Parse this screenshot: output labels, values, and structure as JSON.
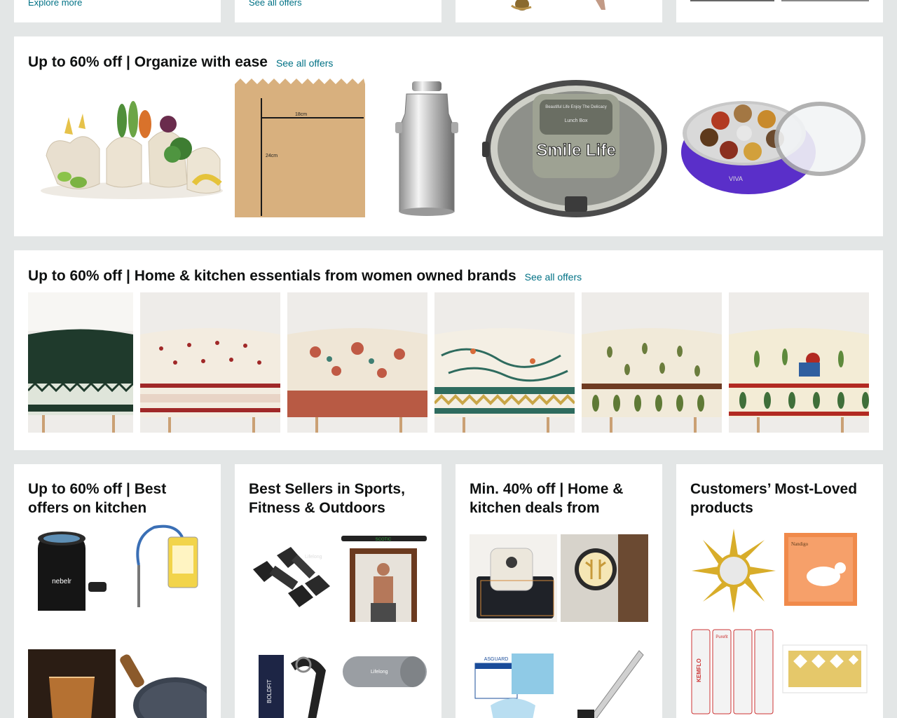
{
  "top_cards": {
    "card1_link": "Explore more",
    "card2_link": "See all offers"
  },
  "organize_row": {
    "title": "Up to 60% off | Organize with ease",
    "link": "See all offers",
    "products": [
      {
        "icon": "vegetable-bags-image"
      },
      {
        "icon": "paper-bag-image",
        "dim_width": "18cm",
        "dim_height": "24cm"
      },
      {
        "icon": "steel-milk-can-image"
      },
      {
        "icon": "lunch-box-image",
        "lid_text": "Beautiful Life Enjoy The Delicacy",
        "label": "Lunch Box",
        "brand": "Smile Life"
      },
      {
        "icon": "spice-box-image",
        "brand": "VIVA"
      }
    ]
  },
  "women_row": {
    "title": "Up to 60% off | Home & kitchen essentials from women owned brands",
    "link": "See all offers",
    "products": [
      {
        "icon": "tablecloth-green-image",
        "color": "#1f3a2c"
      },
      {
        "icon": "tablecloth-red-floral-image",
        "color": "#f3ece0"
      },
      {
        "icon": "tablecloth-rust-floral-image",
        "color": "#efe6d6"
      },
      {
        "icon": "tablecloth-teal-vine-image",
        "color": "#f4efe4"
      },
      {
        "icon": "tablecloth-leaf-image",
        "color": "#f1ead9"
      },
      {
        "icon": "tablecloth-folk-image",
        "color": "#f3ecd6"
      }
    ]
  },
  "quad_cards": [
    {
      "title": "Up to 60% off | Best offers on kitchen",
      "tiles": [
        {
          "icon": "car-air-purifier-image",
          "brand": "nebelr"
        },
        {
          "icon": "oil-pump-image"
        },
        {
          "icon": "whiskey-glass-image"
        },
        {
          "icon": "frying-pan-image"
        }
      ]
    },
    {
      "title": "Best Sellers in Sports, Fitness & Outdoors",
      "tiles": [
        {
          "icon": "dumbbells-image",
          "brand": "Lifelong"
        },
        {
          "icon": "pullup-bar-image",
          "brand": "SCOTIC"
        },
        {
          "icon": "hand-grip-image",
          "brand": "BOLDFIT"
        },
        {
          "icon": "yoga-mat-image",
          "brand": "Lifelong"
        }
      ]
    },
    {
      "title": "Min. 40% off | Home & kitchen deals from",
      "tiles": [
        {
          "icon": "coffee-machine-mat-image"
        },
        {
          "icon": "wall-lamp-image"
        },
        {
          "icon": "face-mask-image",
          "brand": "ASGUARD"
        },
        {
          "icon": "crinkle-cutter-image"
        }
      ]
    },
    {
      "title": "Customers’ Most-Loved products",
      "tiles": [
        {
          "icon": "sun-mirror-image"
        },
        {
          "icon": "cow-art-box-image",
          "brand": "Nandigo"
        },
        {
          "icon": "kemflo-pipes-image",
          "brand": "KEMFLO",
          "label": "Purefit"
        },
        {
          "icon": "gold-border-sticker-image"
        }
      ]
    }
  ]
}
